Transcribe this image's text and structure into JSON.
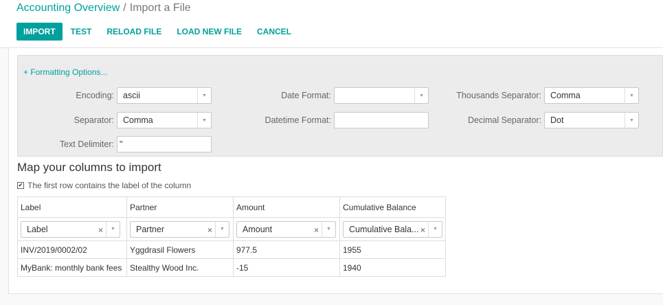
{
  "breadcrumb": {
    "parent": "Accounting Overview",
    "separator": "/",
    "current": "Import a File"
  },
  "toolbar": {
    "import_label": "IMPORT",
    "test_label": "TEST",
    "reload_label": "RELOAD FILE",
    "load_new_label": "LOAD NEW FILE",
    "cancel_label": "CANCEL"
  },
  "formatting": {
    "toggle_label": "+ Formatting Options...",
    "encoding": {
      "label": "Encoding:",
      "value": "ascii"
    },
    "separator": {
      "label": "Separator:",
      "value": "Comma"
    },
    "text_delimiter": {
      "label": "Text Delimiter:",
      "value": "\""
    },
    "date_format": {
      "label": "Date Format:",
      "value": ""
    },
    "datetime_format": {
      "label": "Datetime Format:",
      "value": ""
    },
    "thousands_separator": {
      "label": "Thousands Separator:",
      "value": "Comma"
    },
    "decimal_separator": {
      "label": "Decimal Separator:",
      "value": "Dot"
    }
  },
  "mapping": {
    "title": "Map your columns to import",
    "header_checkbox_label": "The first row contains the label of the column",
    "header_checked": true,
    "columns": [
      {
        "header": "Label",
        "field": "Label"
      },
      {
        "header": "Partner",
        "field": "Partner"
      },
      {
        "header": "Amount",
        "field": "Amount"
      },
      {
        "header": "Cumulative Balance",
        "field": "Cumulative Bala..."
      }
    ],
    "rows": [
      [
        "INV/2019/0002/02",
        "Yggdrasil Flowers",
        "977.5",
        "1955"
      ],
      [
        "MyBank: monthly bank fees",
        "Stealthy Wood Inc.",
        "-15",
        "1940"
      ]
    ]
  },
  "colors": {
    "accent": "#00a09d",
    "panel": "#ececec"
  },
  "icons": {
    "dropdown": "chevron-down-icon",
    "clear": "clear-x-icon",
    "check": "check-icon"
  }
}
